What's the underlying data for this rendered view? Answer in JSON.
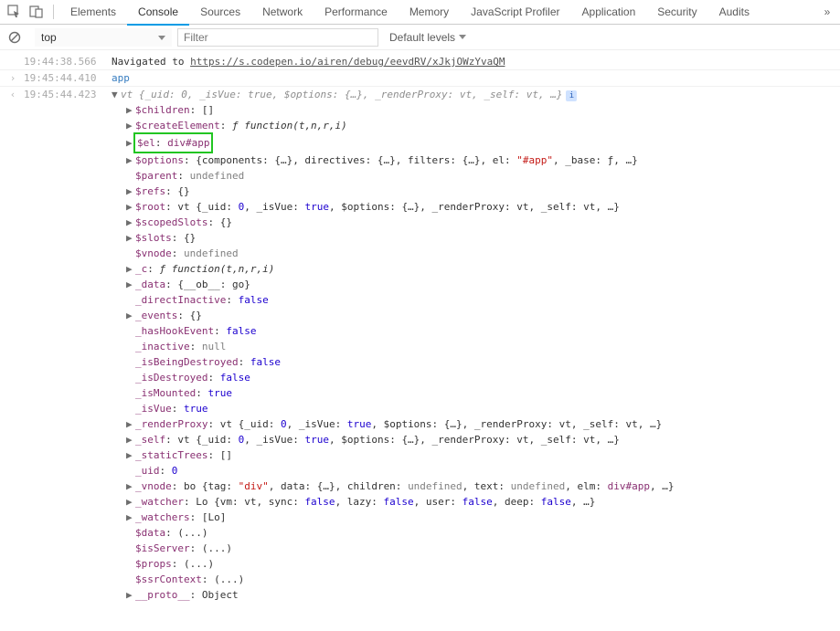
{
  "toolbar": {
    "tabs": [
      "Elements",
      "Console",
      "Sources",
      "Network",
      "Performance",
      "Memory",
      "JavaScript Profiler",
      "Application",
      "Security",
      "Audits"
    ],
    "active_tab": "Console",
    "more": "»"
  },
  "subtoolbar": {
    "context": "top",
    "filter_placeholder": "Filter",
    "levels": "Default levels"
  },
  "log": {
    "rows": [
      {
        "ts": "19:44:38.566",
        "type": "nav",
        "prefix": "Navigated to ",
        "url": "https://s.codepen.io/airen/debug/eevdRV/xJkjOWzYvaQM"
      },
      {
        "ts": "19:45:44.410",
        "type": "input",
        "text": "app"
      },
      {
        "ts": "19:45:44.423",
        "type": "output"
      }
    ]
  },
  "obj_header": {
    "name": "vt",
    "preview": "{_uid: 0, _isVue: true, $options: {…}, _renderProxy: vt, _self: vt, …}",
    "info": "i"
  },
  "props": [
    {
      "arrow": true,
      "key": "$children",
      "raw": ": []"
    },
    {
      "arrow": true,
      "key": "$createElement",
      "raw": ": ",
      "fun": "ƒ function(t,n,r,i)"
    },
    {
      "arrow": true,
      "key": "$el",
      "raw": ": ",
      "txt": "div#app",
      "highlight": true
    },
    {
      "arrow": true,
      "key": "$options",
      "raw": ": {components: {…}, directives: {…}, filters: {…}, el: ",
      "str": "\"#app\"",
      "tail": ", _base: ƒ, …}"
    },
    {
      "arrow": false,
      "key": "$parent",
      "raw": ": ",
      "undef": "undefined"
    },
    {
      "arrow": true,
      "key": "$refs",
      "raw": ": {}"
    },
    {
      "arrow": true,
      "key": "$root",
      "raw": ": vt {_uid: ",
      "num": "0",
      "mid": ", _isVue: ",
      "bool": "true",
      "tail2": ", $options: {…}, _renderProxy: vt, _self: vt, …}"
    },
    {
      "arrow": true,
      "key": "$scopedSlots",
      "raw": ": {}"
    },
    {
      "arrow": true,
      "key": "$slots",
      "raw": ": {}"
    },
    {
      "arrow": false,
      "key": "$vnode",
      "raw": ": ",
      "undef": "undefined"
    },
    {
      "arrow": true,
      "key": "_c",
      "raw": ": ",
      "fun": "ƒ function(t,n,r,i)"
    },
    {
      "arrow": true,
      "key": "_data",
      "raw": ": {__ob__: go}"
    },
    {
      "arrow": false,
      "key": "_directInactive",
      "raw": ": ",
      "bool": "false"
    },
    {
      "arrow": true,
      "key": "_events",
      "raw": ": {}"
    },
    {
      "arrow": false,
      "key": "_hasHookEvent",
      "raw": ": ",
      "bool": "false"
    },
    {
      "arrow": false,
      "key": "_inactive",
      "raw": ": ",
      "undef": "null"
    },
    {
      "arrow": false,
      "key": "_isBeingDestroyed",
      "raw": ": ",
      "bool": "false"
    },
    {
      "arrow": false,
      "key": "_isDestroyed",
      "raw": ": ",
      "bool": "false"
    },
    {
      "arrow": false,
      "key": "_isMounted",
      "raw": ": ",
      "bool": "true"
    },
    {
      "arrow": false,
      "key": "_isVue",
      "raw": ": ",
      "bool": "true"
    },
    {
      "arrow": true,
      "key": "_renderProxy",
      "raw": ": vt {_uid: ",
      "num": "0",
      "mid": ", _isVue: ",
      "bool": "true",
      "tail2": ", $options: {…}, _renderProxy: vt, _self: vt, …}"
    },
    {
      "arrow": true,
      "key": "_self",
      "raw": ": vt {_uid: ",
      "num": "0",
      "mid": ", _isVue: ",
      "bool": "true",
      "tail2": ", $options: {…}, _renderProxy: vt, _self: vt, …}"
    },
    {
      "arrow": true,
      "key": "_staticTrees",
      "raw": ": []"
    },
    {
      "arrow": false,
      "key": "_uid",
      "raw": ": ",
      "num": "0"
    },
    {
      "arrow": true,
      "key": "_vnode",
      "raw": ": bo {tag: ",
      "str": "\"div\"",
      "mid2": ", data: {…}, children: ",
      "undef": "undefined",
      "mid3": ", text: ",
      "undef2": "undefined",
      "mid4": ", elm: ",
      "txt": "div#app",
      "tail3": ", …}"
    },
    {
      "arrow": true,
      "key": "_watcher",
      "raw": ": Lo {vm: vt, sync: ",
      "bool": "false",
      "mid": ", lazy: ",
      "bool2": "false",
      "mid5": ", user: ",
      "bool3": "false",
      "mid6": ", deep: ",
      "bool4": "false",
      "tail4": ", …}"
    },
    {
      "arrow": true,
      "key": "_watchers",
      "raw": ": [Lo]"
    },
    {
      "arrow": false,
      "key": "$data",
      "raw": ": (...)"
    },
    {
      "arrow": false,
      "key": "$isServer",
      "raw": ": (...)"
    },
    {
      "arrow": false,
      "key": "$props",
      "raw": ": (...)"
    },
    {
      "arrow": false,
      "key": "$ssrContext",
      "raw": ": (...)"
    },
    {
      "arrow": true,
      "key": "__proto__",
      "raw": ": Object"
    }
  ]
}
